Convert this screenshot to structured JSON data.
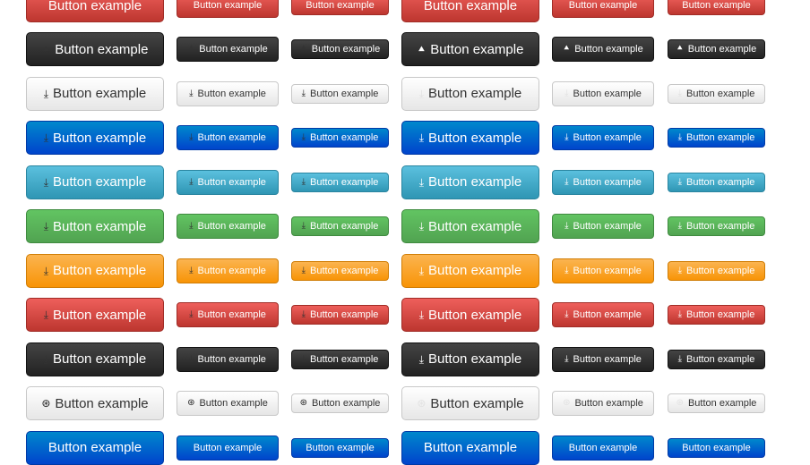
{
  "button_label": "Button example",
  "rows": [
    {
      "variant": "red"
    },
    {
      "variant": "dark",
      "icon": "road-icon"
    },
    {
      "variant": "light",
      "icon": "download-icon"
    },
    {
      "variant": "blue",
      "icon": "download-icon"
    },
    {
      "variant": "cyan",
      "icon": "download-icon"
    },
    {
      "variant": "green",
      "icon": "download-icon"
    },
    {
      "variant": "orange",
      "icon": "download-icon"
    },
    {
      "variant": "red",
      "icon": "download-icon"
    },
    {
      "variant": "dark",
      "icon": "download-icon"
    },
    {
      "variant": "light",
      "icon": "circle-arrow-down-icon"
    },
    {
      "variant": "blue"
    }
  ],
  "icon_glyphs": {
    "road-icon": "⯅",
    "download-icon": "⤓",
    "circle-arrow-down-icon": "⊛"
  },
  "column_iconsets": [
    "dark",
    "dark",
    "dark",
    "white",
    "white",
    "white"
  ],
  "column_sizes": [
    "lg",
    "md",
    "sm",
    "lg",
    "md",
    "sm"
  ],
  "colors": {
    "dark": "#333333",
    "light": "#f0f0f0",
    "blue": "#0055cc",
    "cyan": "#49afcd",
    "green": "#5bb75b",
    "orange": "#faa732",
    "red": "#da4f49"
  }
}
